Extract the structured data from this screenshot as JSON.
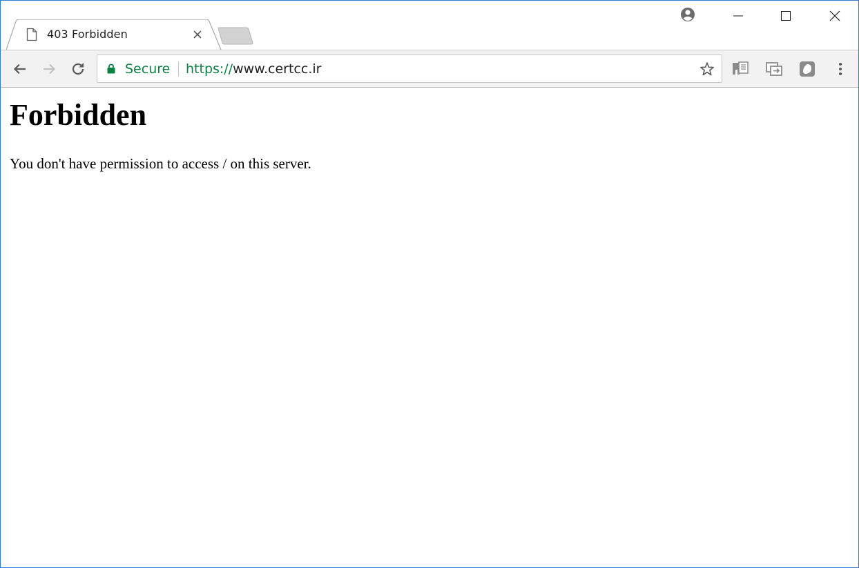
{
  "tab": {
    "title": "403 Forbidden",
    "favicon": "document-icon"
  },
  "window_controls": [
    "minimize",
    "maximize",
    "close"
  ],
  "omnibox": {
    "security_label": "Secure",
    "url_scheme": "https://",
    "url_host": "www.certcc.ir"
  },
  "toolbar_icons": [
    "back-icon",
    "forward-icon",
    "reload-icon",
    "star-icon",
    "extension-1-icon",
    "extension-2-icon",
    "extension-3-icon",
    "menu-icon"
  ],
  "colors": {
    "secure_green": "#0b8043",
    "toolbar_bg": "#f2f2f2",
    "window_border": "#2b7bd1"
  },
  "page": {
    "heading": "Forbidden",
    "message": "You don't have permission to access / on this server."
  }
}
